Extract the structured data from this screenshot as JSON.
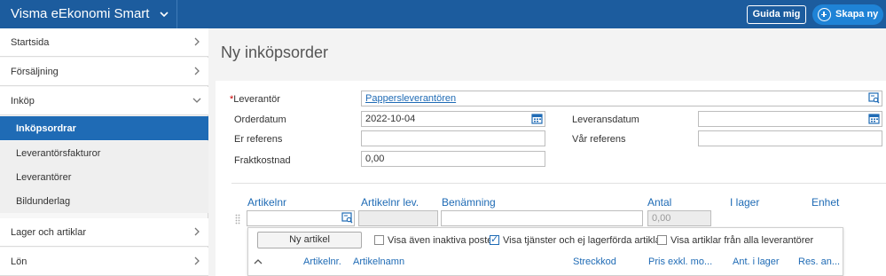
{
  "app": {
    "title": "Visma eEkonomi Smart",
    "guide_label": "Guida mig",
    "create_label": "Skapa ny"
  },
  "sidebar": {
    "items": [
      {
        "label": "Startsida"
      },
      {
        "label": "Försäljning"
      },
      {
        "label": "Inköp"
      }
    ],
    "sub_items": [
      {
        "label": "Inköpsordrar",
        "active": true
      },
      {
        "label": "Leverantörsfakturor"
      },
      {
        "label": "Leverantörer"
      },
      {
        "label": "Bildunderlag"
      }
    ],
    "items_after": [
      {
        "label": "Lager och artiklar"
      },
      {
        "label": "Lön"
      }
    ]
  },
  "page": {
    "title": "Ny inköpsorder"
  },
  "form": {
    "supplier_label": "Leverantör",
    "supplier_required_mark": "*",
    "supplier_value": "Pappersleverantören",
    "order_date_label": "Orderdatum",
    "order_date_value": "2022-10-04",
    "delivery_date_label": "Leveransdatum",
    "delivery_date_value": "",
    "your_ref_label": "Er referens",
    "your_ref_value": "",
    "our_ref_label": "Vår referens",
    "our_ref_value": "",
    "freight_label": "Fraktkostnad",
    "freight_value": "0,00"
  },
  "rows_table": {
    "columns": [
      "Artikelnr",
      "Artikelnr lev.",
      "Benämning",
      "Antal",
      "I lager",
      "Enhet"
    ],
    "qty_placeholder": "0,00"
  },
  "article_popup": {
    "new_article_label": "Ny artikel",
    "checkboxes": [
      {
        "label": "Visa även inaktiva poster",
        "checked": false
      },
      {
        "label": "Visa tjänster och ej lagerförda artiklar",
        "checked": true
      },
      {
        "label": "Visa artiklar från alla leverantörer",
        "checked": false
      }
    ],
    "columns": [
      "Artikelnr.",
      "Artikelnamn",
      "Streckkod",
      "Pris exkl. mo...",
      "Ant. i lager",
      "Res. an..."
    ]
  },
  "colors": {
    "topbar": "#1c5c9e",
    "accent": "#1f6bb5",
    "create_button": "#1f83d6"
  }
}
